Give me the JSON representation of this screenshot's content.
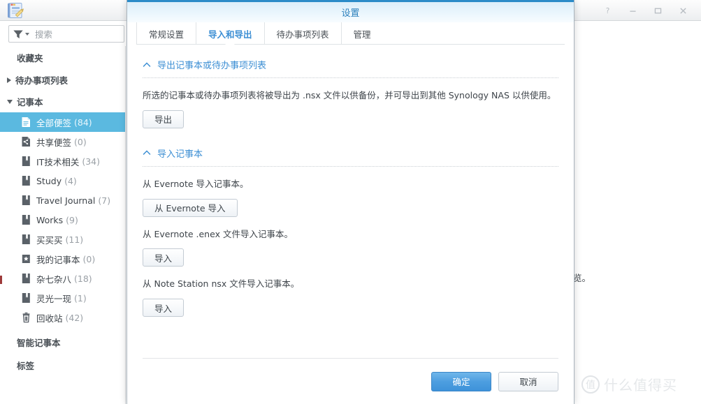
{
  "app": {
    "icon_name": "note-station-app-icon",
    "search": {
      "placeholder": "搜索",
      "filter_icon": "funnel-icon",
      "dropdown_icon": "caret-down-icon"
    },
    "window_controls": [
      {
        "name": "help-button",
        "glyph": "?"
      },
      {
        "name": "minimize-button",
        "glyph": "—"
      },
      {
        "name": "maximize-button",
        "glyph": "□"
      },
      {
        "name": "close-button",
        "glyph": "✕"
      }
    ],
    "background_text": "览。",
    "watermark": {
      "logo": "值",
      "text": "什么值得买"
    }
  },
  "sidebar": {
    "favorites_label": "收藏夹",
    "todo_group_label": "待办事项列表",
    "notebook_group_label": "记事本",
    "notebooks": [
      {
        "label": "全部便签",
        "count": "(84)",
        "icon": "all-notes-icon",
        "selected": true
      },
      {
        "label": "共享便签",
        "count": "(0)",
        "icon": "shared-notes-icon",
        "selected": false
      },
      {
        "label": "IT技术相关",
        "count": "(34)",
        "icon": "notebook-icon",
        "selected": false
      },
      {
        "label": "Study",
        "count": "(4)",
        "icon": "notebook-icon",
        "selected": false
      },
      {
        "label": "Travel Journal",
        "count": "(7)",
        "icon": "notebook-icon",
        "selected": false
      },
      {
        "label": "Works",
        "count": "(9)",
        "icon": "notebook-icon",
        "selected": false
      },
      {
        "label": "买买买",
        "count": "(11)",
        "icon": "notebook-icon",
        "selected": false
      },
      {
        "label": "我的记事本",
        "count": "(0)",
        "icon": "star-notebook-icon",
        "selected": false
      },
      {
        "label": "杂七杂八",
        "count": "(18)",
        "icon": "notebook-icon",
        "selected": false
      },
      {
        "label": "灵光一现",
        "count": "(1)",
        "icon": "notebook-icon",
        "selected": false
      },
      {
        "label": "回收站",
        "count": "(42)",
        "icon": "trash-icon",
        "selected": false
      }
    ],
    "smart_notebook_label": "智能记事本",
    "tags_label": "标签"
  },
  "dialog": {
    "title": "设置",
    "tabs": [
      {
        "label": "常规设置",
        "active": false
      },
      {
        "label": "导入和导出",
        "active": true
      },
      {
        "label": "待办事项列表",
        "active": false
      },
      {
        "label": "管理",
        "active": false
      }
    ],
    "sections": [
      {
        "heading": "导出记事本或待办事项列表",
        "collapse_icon": "chevron-up-icon",
        "rows": [
          {
            "text": "所选的记事本或待办事项列表将被导出为 .nsx 文件以供备份，并可导出到其他 Synology NAS 以供使用。",
            "button": "导出"
          }
        ]
      },
      {
        "heading": "导入记事本",
        "collapse_icon": "chevron-up-icon",
        "rows": [
          {
            "text": "从 Evernote 导入记事本。",
            "button": "从 Evernote 导入"
          },
          {
            "text": "从 Evernote .enex 文件导入记事本。",
            "button": "导入"
          },
          {
            "text": "从 Note Station nsx 文件导入记事本。",
            "button": "导入"
          }
        ]
      }
    ],
    "footer": {
      "ok_label": "确定",
      "cancel_label": "取消"
    }
  }
}
